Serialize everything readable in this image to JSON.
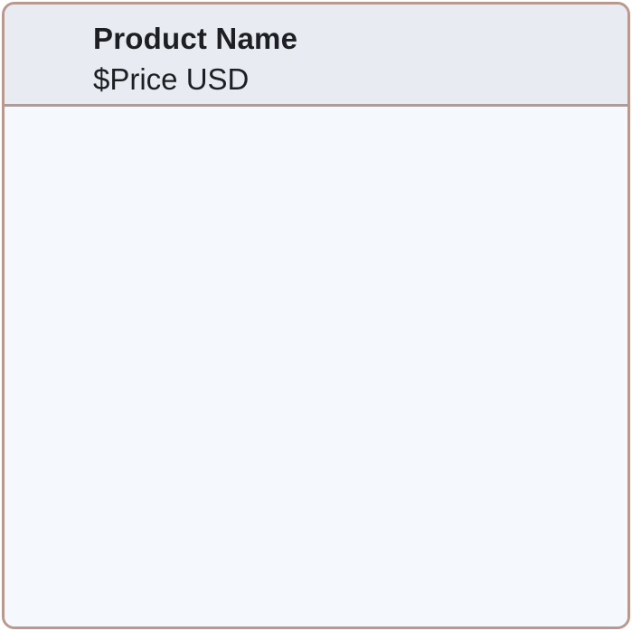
{
  "product": {
    "name": "Product Name",
    "price": "$Price USD"
  },
  "colors": {
    "border": "#b9988f",
    "header_bg": "#e8ecf2",
    "body_bg": "#f5f9fd",
    "text": "#1d1f22"
  }
}
